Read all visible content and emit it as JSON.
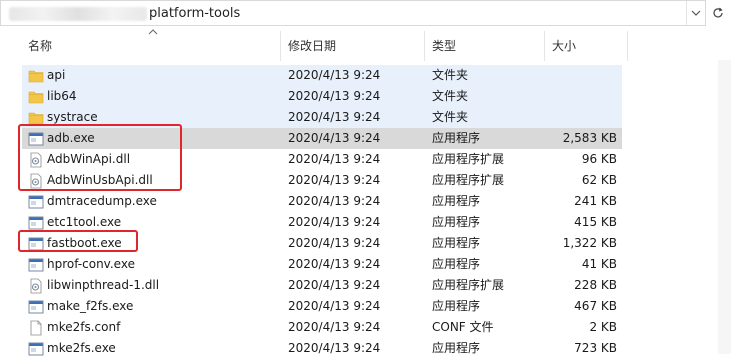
{
  "address": {
    "path": "platform-tools"
  },
  "columns": {
    "name": "名称",
    "date": "修改日期",
    "type": "类型",
    "size": "大小"
  },
  "rows": [
    {
      "name": "api",
      "date": "2020/4/13 9:24",
      "type": "文件夹",
      "size": "",
      "icon": "folder-icon"
    },
    {
      "name": "lib64",
      "date": "2020/4/13 9:24",
      "type": "文件夹",
      "size": "",
      "icon": "folder-icon"
    },
    {
      "name": "systrace",
      "date": "2020/4/13 9:24",
      "type": "文件夹",
      "size": "",
      "icon": "folder-icon"
    },
    {
      "name": "adb.exe",
      "date": "2020/4/13 9:24",
      "type": "应用程序",
      "size": "2,583 KB",
      "icon": "exe-icon"
    },
    {
      "name": "AdbWinApi.dll",
      "date": "2020/4/13 9:24",
      "type": "应用程序扩展",
      "size": "96 KB",
      "icon": "dll-icon"
    },
    {
      "name": "AdbWinUsbApi.dll",
      "date": "2020/4/13 9:24",
      "type": "应用程序扩展",
      "size": "62 KB",
      "icon": "dll-icon"
    },
    {
      "name": "dmtracedump.exe",
      "date": "2020/4/13 9:24",
      "type": "应用程序",
      "size": "241 KB",
      "icon": "exe-icon"
    },
    {
      "name": "etc1tool.exe",
      "date": "2020/4/13 9:24",
      "type": "应用程序",
      "size": "415 KB",
      "icon": "exe-icon"
    },
    {
      "name": "fastboot.exe",
      "date": "2020/4/13 9:24",
      "type": "应用程序",
      "size": "1,322 KB",
      "icon": "exe-icon"
    },
    {
      "name": "hprof-conv.exe",
      "date": "2020/4/13 9:24",
      "type": "应用程序",
      "size": "41 KB",
      "icon": "exe-icon"
    },
    {
      "name": "libwinpthread-1.dll",
      "date": "2020/4/13 9:24",
      "type": "应用程序扩展",
      "size": "228 KB",
      "icon": "dll-icon"
    },
    {
      "name": "make_f2fs.exe",
      "date": "2020/4/13 9:24",
      "type": "应用程序",
      "size": "467 KB",
      "icon": "exe-icon"
    },
    {
      "name": "mke2fs.conf",
      "date": "2020/4/13 9:24",
      "type": "CONF 文件",
      "size": "2 KB",
      "icon": "file-icon"
    },
    {
      "name": "mke2fs.exe",
      "date": "2020/4/13 9:24",
      "type": "应用程序",
      "size": "723 KB",
      "icon": "exe-icon"
    }
  ],
  "selected_row": 3,
  "colors": {
    "highlight": "#e0262d",
    "folder": "#f3c548",
    "selected": "#d9d9d9"
  }
}
